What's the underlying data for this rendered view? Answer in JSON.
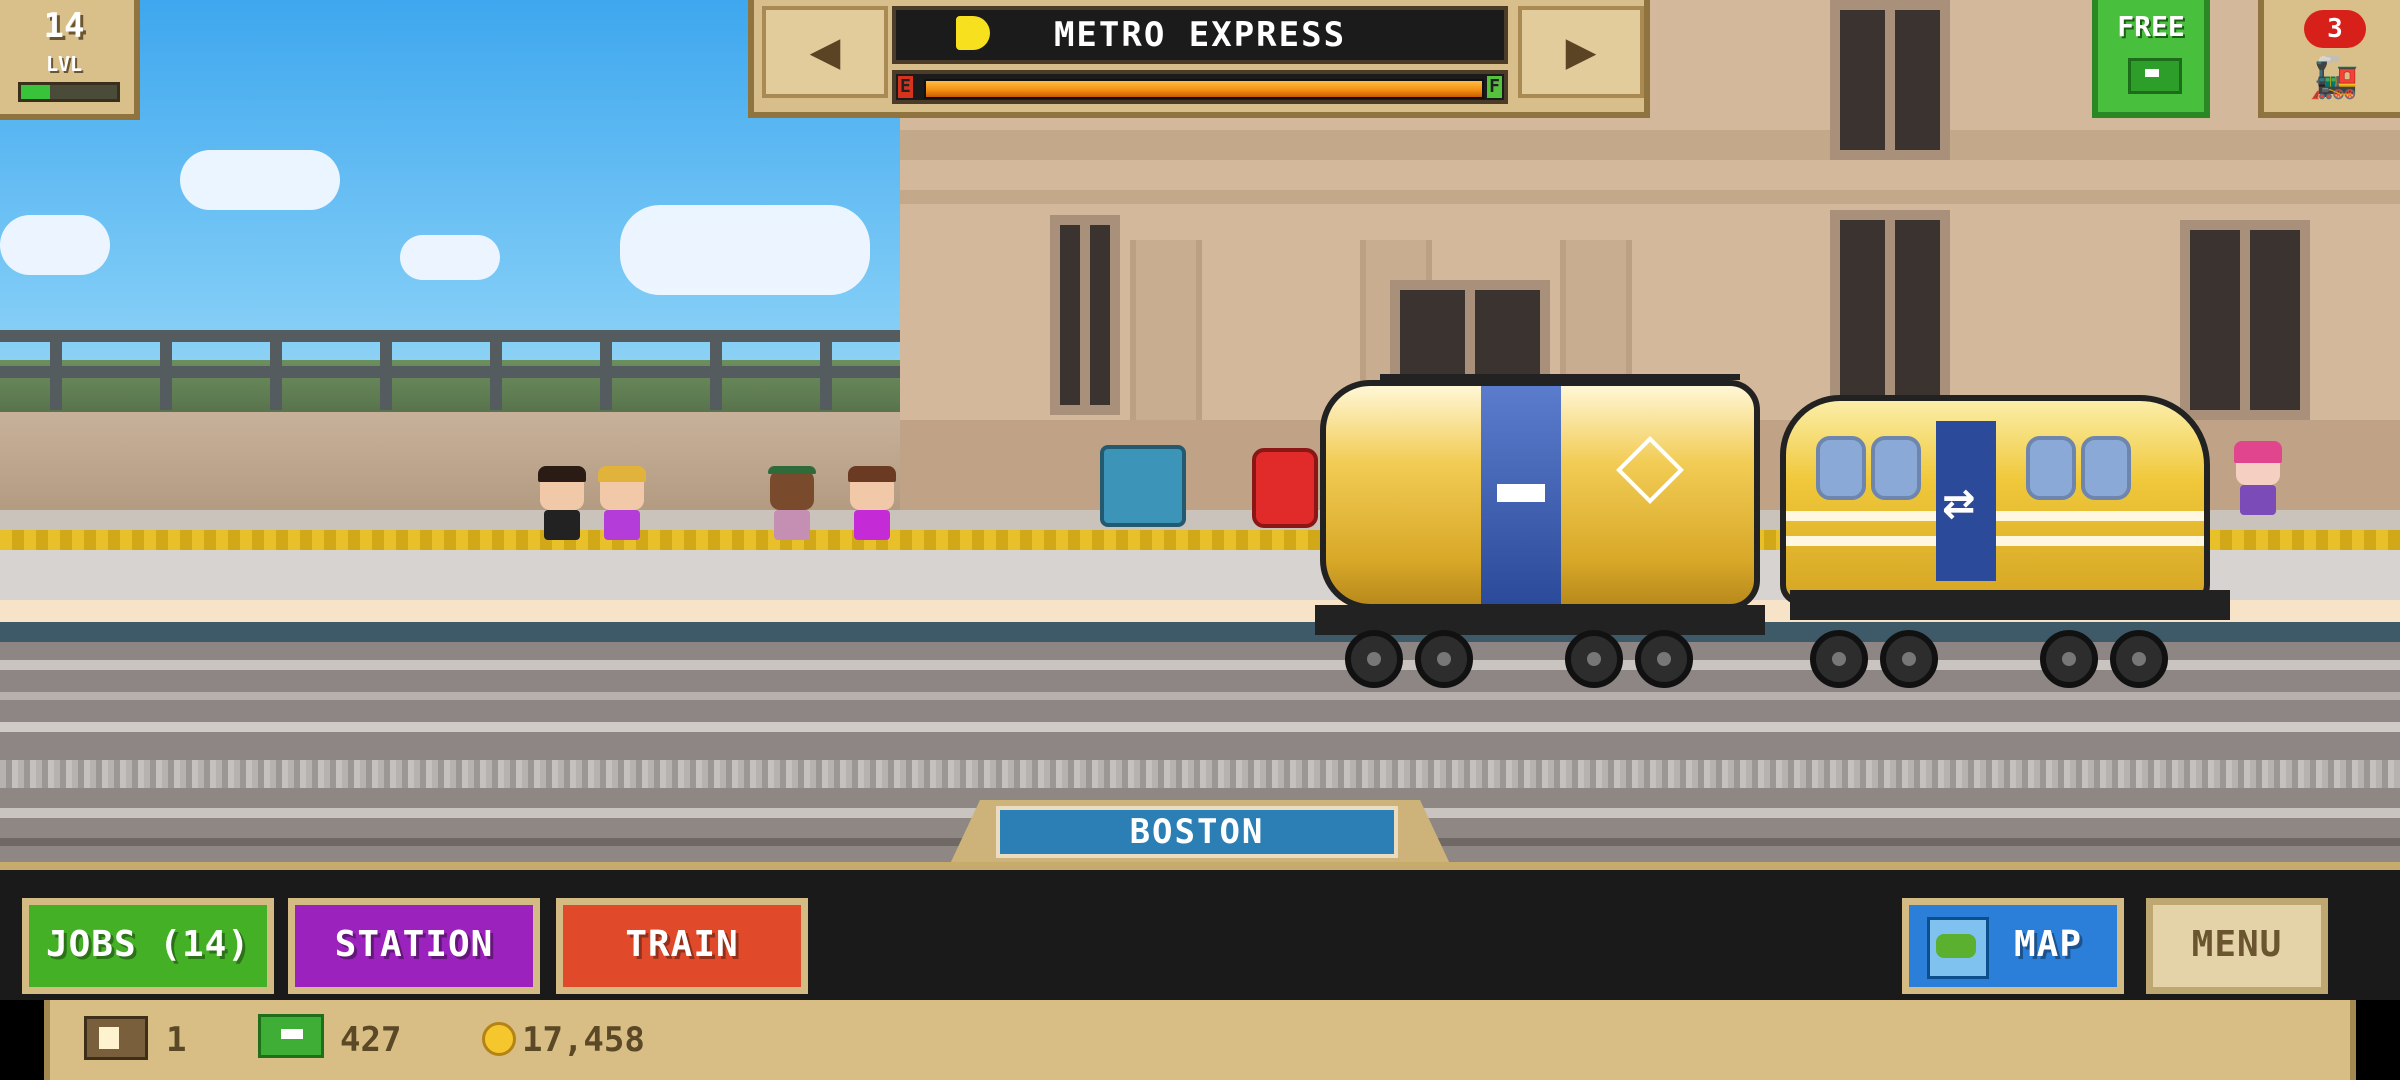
{
  "hud": {
    "level_value": "14",
    "level_label": "LVL",
    "level_progress": 0.3
  },
  "train_selector": {
    "prev_arrow": "◀",
    "next_arrow": "▶",
    "train_name": "METRO EXPRESS",
    "fuel_empty_label": "E",
    "fuel_full_label": "F",
    "fuel_level": 1.0
  },
  "free_button": {
    "label": "FREE"
  },
  "engines_button": {
    "badge": "3"
  },
  "station": {
    "name": "BOSTON"
  },
  "actions": {
    "jobs": "JOBS (14)",
    "station": "STATION",
    "train": "TRAIN",
    "map": "MAP",
    "menu": "MENU"
  },
  "resources": {
    "tickets": "1",
    "cash": "427",
    "coins": "17,458"
  },
  "colors": {
    "sky": "#3ea7ee",
    "jobs_button": "#43b025",
    "station_button": "#9c22bd",
    "train_button": "#e04a2a",
    "map_button": "#2b7fd9",
    "station_sign": "#2b7fb4",
    "free_button": "#49c03d",
    "badge_red": "#d8201a"
  },
  "icons": {
    "train_name_icon": "train-front-icon",
    "map_icon": "map-icon",
    "engine_icon": "locomotive-icon",
    "free_icon": "cash-icon",
    "ticket_icon": "ticket-icon",
    "cash_icon": "cash-icon",
    "coin_icon": "coin-icon"
  }
}
